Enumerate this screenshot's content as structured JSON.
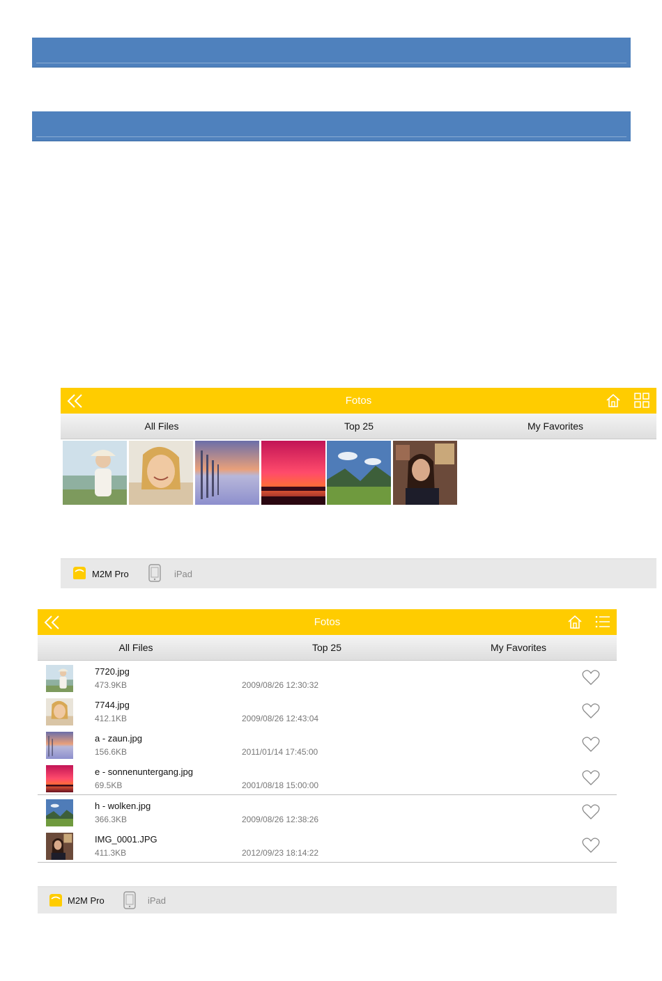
{
  "colors": {
    "accent": "#ffcc00",
    "heading_bar": "#4f81bd",
    "tabbar": "#e6e6e6"
  },
  "grid_view": {
    "title": "Fotos",
    "tabs": [
      "All Files",
      "Top 25",
      "My Favorites"
    ],
    "thumbnails": [
      "7720.jpg",
      "7744.jpg",
      "a - zaun.jpg",
      "e - sonnenuntergang.jpg",
      "h - wolken.jpg",
      "IMG_0001.JPG"
    ],
    "bottom": {
      "app_label": "M2M Pro",
      "device_label": "iPad"
    },
    "icons": {
      "back": "double-chevron-left-icon",
      "home": "home-icon",
      "view_toggle": "grid-view-icon"
    }
  },
  "list_view": {
    "title": "Fotos",
    "tabs": [
      "All Files",
      "Top 25",
      "My Favorites"
    ],
    "files": [
      {
        "name": "7720.jpg",
        "size": "473.9KB",
        "date": "2009/08/26 12:30:32"
      },
      {
        "name": "7744.jpg",
        "size": "412.1KB",
        "date": "2009/08/26 12:43:04"
      },
      {
        "name": "a - zaun.jpg",
        "size": "156.6KB",
        "date": "2011/01/14 17:45:00"
      },
      {
        "name": "e - sonnenuntergang.jpg",
        "size": "69.5KB",
        "date": "2001/08/18 15:00:00"
      },
      {
        "name": "h - wolken.jpg",
        "size": "366.3KB",
        "date": "2009/08/26 12:38:26"
      },
      {
        "name": "IMG_0001.JPG",
        "size": "411.3KB",
        "date": "2012/09/23 18:14:22"
      }
    ],
    "bottom": {
      "app_label": "M2M Pro",
      "device_label": "iPad"
    },
    "icons": {
      "back": "double-chevron-left-icon",
      "home": "home-icon",
      "view_toggle": "list-view-icon",
      "favorite": "heart-outline-icon"
    }
  }
}
